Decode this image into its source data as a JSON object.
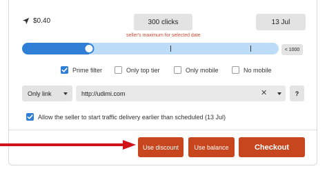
{
  "price": {
    "icon": "navigation-arrow-icon",
    "value": "$0.40"
  },
  "clicks_button": "300 clicks",
  "date_button": "13 Jul",
  "limit_hint": "seller's maximum for selected date",
  "slider": {
    "level": 0.26,
    "limit_label": "< 1000"
  },
  "filters": [
    {
      "label": "Prime filter",
      "checked": true
    },
    {
      "label": "Only top tier",
      "checked": false
    },
    {
      "label": "Only mobile",
      "checked": false
    },
    {
      "label": "No mobile",
      "checked": false
    }
  ],
  "link_select": {
    "value": "Only link"
  },
  "url_field": {
    "value": "http://udimi.com",
    "clear_icon": "close-icon"
  },
  "help_button": "?",
  "allow_early": {
    "label": "Allow the seller to start traffic delivery earlier than scheduled (13 Jul)",
    "checked": true
  },
  "actions": {
    "discount": "Use discount",
    "balance": "Use balance",
    "checkout": "Checkout"
  },
  "colors": {
    "accent_blue": "#2f7fd6",
    "track_blue": "#bcdcf7",
    "action_red": "#c7461d",
    "hint_red": "#d04a2f",
    "annotation_arrow": "#d0121b"
  }
}
